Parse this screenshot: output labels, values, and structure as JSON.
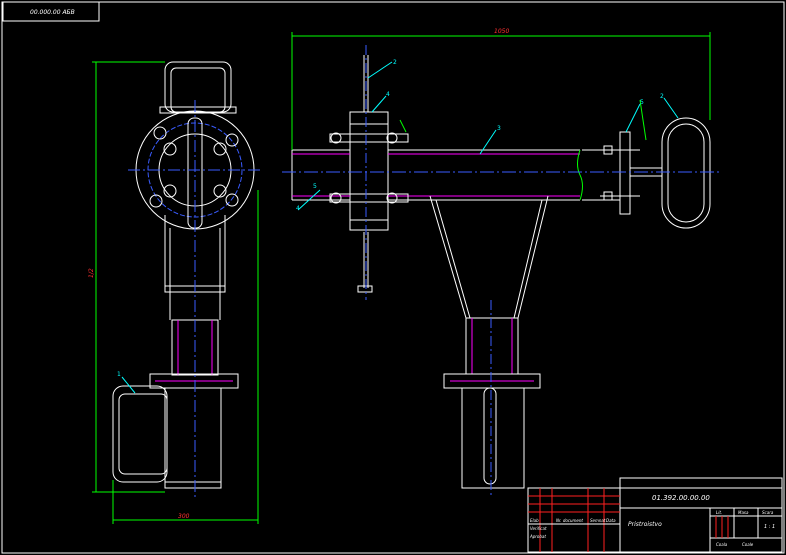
{
  "colors": {
    "background": "#000000",
    "outline": "#ffffff",
    "dimension": "#00ff00",
    "centerline": "#3a5cff",
    "hidden": "#ff00ff",
    "leader": "#00ffff",
    "frame_red": "#ff2020",
    "number": "#ff3030"
  },
  "corner_stamp": "00.000.00 АБВ",
  "dimensions": {
    "left_height": "1/2",
    "left_width": "300",
    "right_width": "1050"
  },
  "part_numbers": {
    "p1": "1",
    "p2_top": "2",
    "p2_right": "2",
    "p3": "3",
    "p4_top": "4",
    "p4_left": "4",
    "p5_left": "5",
    "p5_right": "5"
  },
  "title_block": {
    "designation": "01.392.00.00.00",
    "name": "Pristroistvo",
    "col_lit": "Lit.",
    "col_mass": "Masa",
    "col_scale": "Scara",
    "scale_value": "1 : 1",
    "sheet": "Coala",
    "sheets": "Coale",
    "row_elab": "Elab",
    "row_verif": "Verificat",
    "row_aprob": "Aprobat",
    "col_ndoc": "Nr. document",
    "col_semn": "Semnat",
    "col_data": "Data"
  }
}
